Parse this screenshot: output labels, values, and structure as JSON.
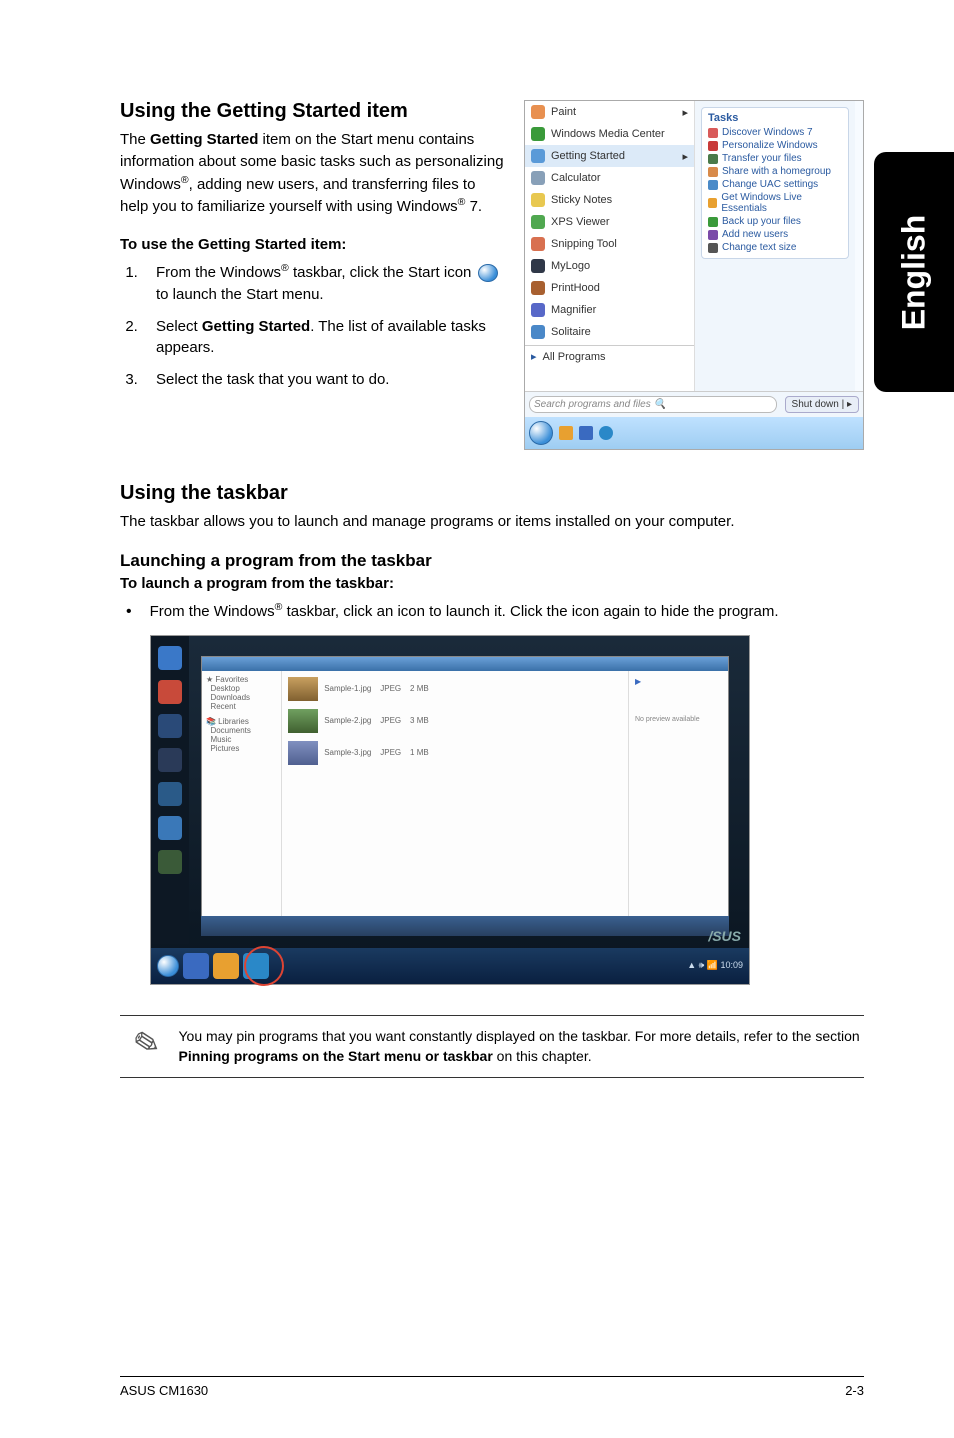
{
  "sideTab": "English",
  "sec1": {
    "heading": "Using the Getting Started item",
    "intro_parts": {
      "a": "The ",
      "b": "Getting Started",
      "c": " item on the Start menu contains information about some basic tasks such as personalizing Windows",
      "d": ", adding new users, and transferring files to help you to familiarize yourself with using Windows",
      "e": " 7."
    },
    "subheading": "To use the Getting Started item:",
    "steps": {
      "s1a": "From the Windows",
      "s1b": " taskbar, click the Start icon ",
      "s1c": " to launch the Start menu.",
      "s2a": "Select ",
      "s2b": "Getting Started",
      "s2c": ". The list of available tasks appears.",
      "s3": "Select the task that you want to do."
    }
  },
  "startmenu": {
    "items": [
      "Paint",
      "Windows Media Center",
      "Getting Started",
      "Calculator",
      "Sticky Notes",
      "XPS Viewer",
      "Snipping Tool",
      "MyLogo",
      "PrintHood",
      "Magnifier",
      "Solitaire"
    ],
    "allPrograms": "All Programs",
    "searchPlaceholder": "Search programs and files",
    "shutdown": "Shut down",
    "tasksTitle": "Tasks",
    "tasks": [
      "Discover Windows 7",
      "Personalize Windows",
      "Transfer your files",
      "Share with a homegroup",
      "Change UAC settings",
      "Get Windows Live Essentials",
      "Back up your files",
      "Add new users",
      "Change text size"
    ]
  },
  "sec2": {
    "heading": "Using the taskbar",
    "para": "The taskbar allows you to launch and manage programs or items installed on your computer.",
    "sub": "Launching a program from the taskbar",
    "sub2": "To launch a program from the taskbar:",
    "bullet_a": "From the Windows",
    "bullet_b": " taskbar, click an icon to launch it. Click the icon again to hide the program."
  },
  "note": {
    "a": "You may pin programs that you want constantly displayed on the taskbar. For more details, refer to the section ",
    "b": "Pinning programs on the Start menu or taskbar",
    "c": " on this chapter."
  },
  "footer": {
    "left": "ASUS CM1630",
    "right": "2-3"
  },
  "reg": "®"
}
